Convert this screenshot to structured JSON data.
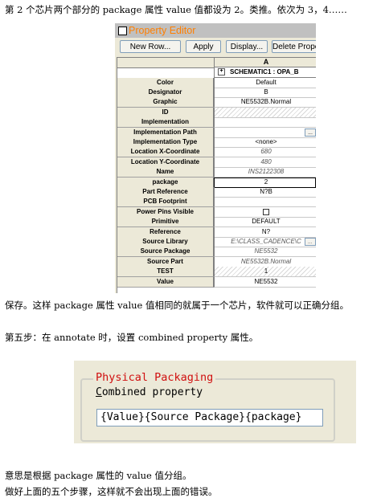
{
  "text": {
    "p1": "第 2 个芯片两个部分的 package 属性 value 值都设为 2。类推。依次为 3，4……",
    "p2": "保存。这样 package 属性 value 值相同的就属于一个芯片，软件就可以正确分组。",
    "p3": "第五步：在 annotate 时，设置 combined property 属性。",
    "p4": "意思是根据 package 属性的 value 值分组。",
    "p5": "做好上面的五个步骤，这样就不会出现上面的错误。"
  },
  "editor": {
    "title": "Property Editor",
    "buttons": [
      "New Row...",
      "Apply",
      "Display...",
      "Delete Property"
    ],
    "column_header": "A",
    "expand_symbol": "+",
    "schematic": "SCHEMATIC1 : OPA_B",
    "rows": [
      {
        "label": "Color",
        "value": "Default"
      },
      {
        "label": "Designator",
        "value": "B"
      },
      {
        "label": "Graphic",
        "value": "NE5532B.Normal"
      },
      {
        "label": "ID",
        "value": ""
      },
      {
        "label": "Implementation",
        "value": ""
      },
      {
        "label": "Implementation Path",
        "value": ""
      },
      {
        "label": "Implementation Type",
        "value": "<none>"
      },
      {
        "label": "Location X-Coordinate",
        "value": "680"
      },
      {
        "label": "Location Y-Coordinate",
        "value": "480"
      },
      {
        "label": "Name",
        "value": "INS2122308"
      },
      {
        "label": "package",
        "value": "2"
      },
      {
        "label": "Part Reference",
        "value": "N?B"
      },
      {
        "label": "PCB Footprint",
        "value": ""
      },
      {
        "label": "Power Pins Visible",
        "value": ""
      },
      {
        "label": "Primitive",
        "value": "DEFAULT"
      },
      {
        "label": "Reference",
        "value": "N?"
      },
      {
        "label": "Source Library",
        "value": "E:\\CLASS_CADENCE\\C"
      },
      {
        "label": "Source Package",
        "value": "NE5532"
      },
      {
        "label": "Source Part",
        "value": "NE5532B.Normal"
      },
      {
        "label": "TEST",
        "value": "1"
      },
      {
        "label": "Value",
        "value": "NE5532"
      }
    ],
    "browse_label": "..."
  },
  "packaging": {
    "legend": "Physical Packaging",
    "label": "Combined property",
    "value": "{Value}{Source Package}{package}"
  },
  "colors": {
    "title_text": "#ff7f00",
    "legend_text": "#d01010"
  }
}
